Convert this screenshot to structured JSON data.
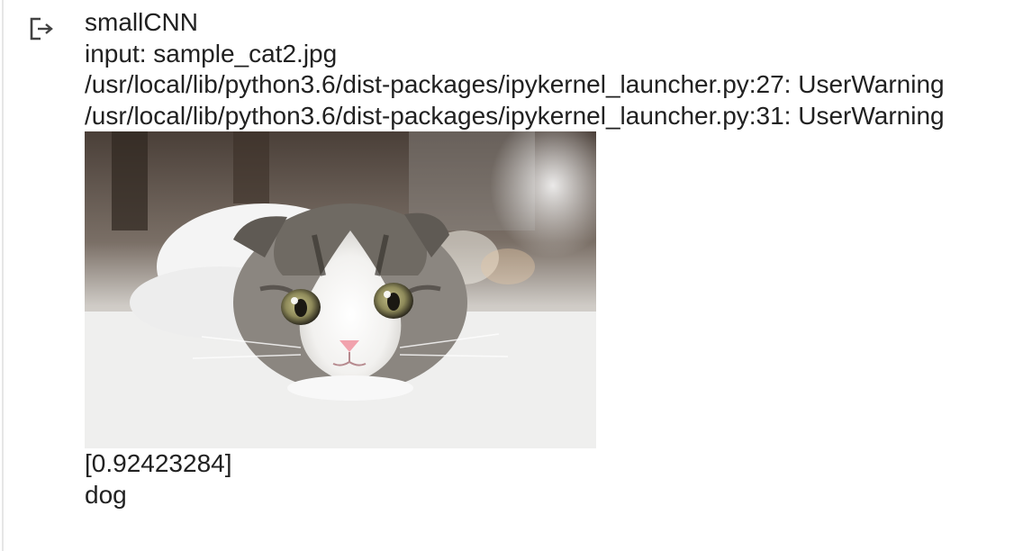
{
  "output": {
    "icon": "output-redirect-icon",
    "lines": [
      "smallCNN",
      "input: sample_cat2.jpg",
      "/usr/local/lib/python3.6/dist-packages/ipykernel_launcher.py:27: UserWarning",
      "/usr/local/lib/python3.6/dist-packages/ipykernel_launcher.py:31: UserWarning"
    ],
    "image": {
      "subject": "cat-photo"
    },
    "prediction_score": "[0.92423284]",
    "prediction_label": "dog"
  },
  "colors": {
    "text": "#212121",
    "border": "#e6e6e6",
    "icon": "#616161"
  }
}
